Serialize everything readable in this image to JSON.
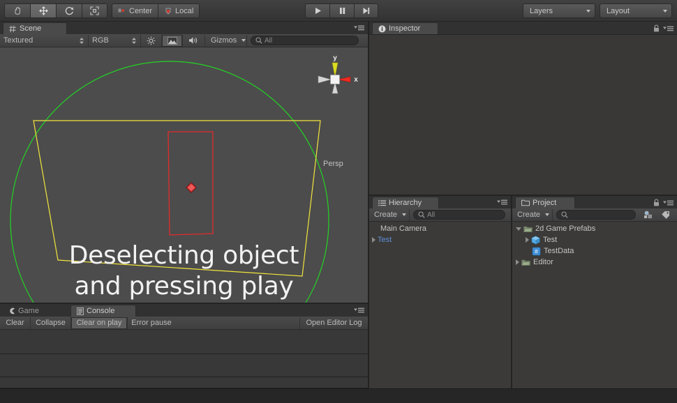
{
  "toolbar": {
    "tools": [
      {
        "name": "hand-tool",
        "icon": "hand-icon",
        "active": false
      },
      {
        "name": "move-tool",
        "icon": "move-icon",
        "active": true
      },
      {
        "name": "rotate-tool",
        "icon": "rotate-icon",
        "active": false
      },
      {
        "name": "scale-tool",
        "icon": "scale-icon",
        "active": false
      }
    ],
    "pivot_mode_label": "Center",
    "pivot_rotation_label": "Local",
    "play_label": "play-icon",
    "pause_label": "pause-icon",
    "step_label": "step-icon",
    "layers_label": "Layers",
    "layout_label": "Layout"
  },
  "scene": {
    "tab_label": "Scene",
    "draw_mode": "Textured",
    "render_mode": "RGB",
    "gizmos_label": "Gizmos",
    "search_placeholder": "All",
    "search_value": "",
    "camera_mode_label": "Persp",
    "axis_x_label": "x",
    "axis_y_label": "y",
    "overlay_line_1": "Deselecting object",
    "overlay_line_2": "and pressing play",
    "colors": {
      "collider_green": "#23d424",
      "camera_yellow": "#f2e53d",
      "selection_red": "#e32b2b",
      "gizmo_x": "#ee2b21",
      "gizmo_y": "#dbdb21",
      "background": "#4c4c4c"
    }
  },
  "console": {
    "tabs": [
      {
        "label": "Game",
        "icon": "game-icon",
        "active": false
      },
      {
        "label": "Console",
        "icon": "console-icon",
        "active": true
      }
    ],
    "buttons": [
      {
        "label": "Clear",
        "pressed": false
      },
      {
        "label": "Collapse",
        "pressed": false
      },
      {
        "label": "Clear on play",
        "pressed": true
      },
      {
        "label": "Error pause",
        "pressed": false
      }
    ],
    "open_editor_log_label": "Open Editor Log",
    "rows": [
      "",
      "",
      ""
    ]
  },
  "inspector": {
    "tab_label": "Inspector",
    "lock_icon": "lock-icon",
    "menu_icon": "hamburger-icon"
  },
  "hierarchy": {
    "tab_label": "Hierarchy",
    "create_label": "Create",
    "search_placeholder": "All",
    "search_value": "",
    "items": [
      {
        "label": "Main Camera",
        "indent": 0,
        "expandable": false,
        "prefab": false
      },
      {
        "label": "Test",
        "indent": 0,
        "expandable": true,
        "prefab": true
      }
    ]
  },
  "project": {
    "tab_label": "Project",
    "create_label": "Create",
    "search_placeholder": "",
    "search_value": "",
    "items": [
      {
        "label": "2d Game Prefabs",
        "indent": 0,
        "expandable": true,
        "expanded": true,
        "icon": "folder-icon"
      },
      {
        "label": "Test",
        "indent": 1,
        "expandable": true,
        "expanded": false,
        "icon": "prefab-icon"
      },
      {
        "label": "TestData",
        "indent": 1,
        "expandable": false,
        "expanded": false,
        "icon": "script-icon"
      },
      {
        "label": "Editor",
        "indent": 0,
        "expandable": true,
        "expanded": false,
        "icon": "folder-icon"
      }
    ]
  }
}
